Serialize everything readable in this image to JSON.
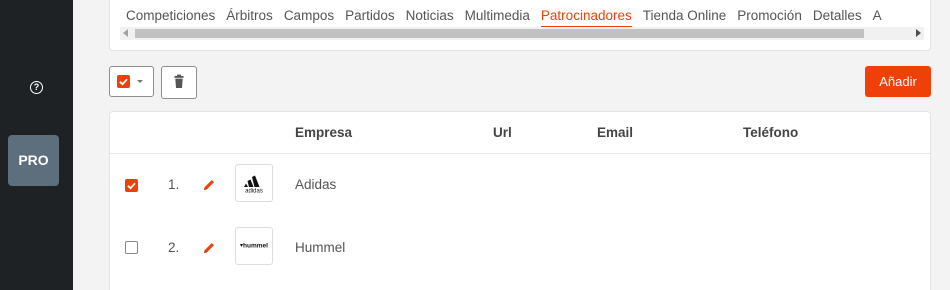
{
  "sidebar": {
    "help_icon": "question-circle-icon",
    "pro_label": "PRO"
  },
  "tabs": [
    {
      "label": "Competiciones",
      "active": false
    },
    {
      "label": "Árbitros",
      "active": false
    },
    {
      "label": "Campos",
      "active": false
    },
    {
      "label": "Partidos",
      "active": false
    },
    {
      "label": "Noticias",
      "active": false
    },
    {
      "label": "Multimedia",
      "active": false
    },
    {
      "label": "Patrocinadores",
      "active": true
    },
    {
      "label": "Tienda Online",
      "active": false
    },
    {
      "label": "Promoción",
      "active": false
    },
    {
      "label": "Detalles",
      "active": false
    },
    {
      "label": "A",
      "active": false
    }
  ],
  "toolbar": {
    "add_label": "Añadir",
    "delete_icon": "trash-icon",
    "select_icon": "checkbox-dropdown-icon"
  },
  "table": {
    "columns": [
      "Empresa",
      "Url",
      "Email",
      "Teléfono"
    ],
    "rows": [
      {
        "checked": true,
        "index": "1.",
        "empresa": "Adidas",
        "url": "",
        "email": "",
        "telefono": "",
        "logo_text": "adidas"
      },
      {
        "checked": false,
        "index": "2.",
        "empresa": "Hummel",
        "url": "",
        "email": "",
        "telefono": "",
        "logo_text": "hummel"
      }
    ]
  },
  "colors": {
    "accent": "#f0400a",
    "sidebar_bg": "#1f2225",
    "pro_badge_bg": "#5d6e7c"
  }
}
